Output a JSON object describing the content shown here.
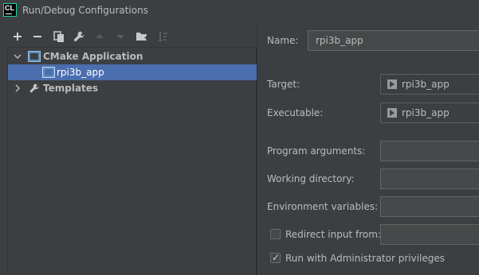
{
  "window": {
    "title": "Run/Debug Configurations",
    "logo_text": "CL"
  },
  "toolbar": {
    "buttons": [
      "add",
      "remove",
      "copy",
      "edit-defaults",
      "move-up",
      "move-down",
      "new-folder",
      "sort"
    ]
  },
  "tree": {
    "items": [
      {
        "label": "CMake Application",
        "expanded": true,
        "bold": true
      },
      {
        "label": "rpi3b_app",
        "selected": true
      },
      {
        "label": "Templates",
        "expanded": false,
        "bold": true
      }
    ]
  },
  "form": {
    "name_label": "Name:",
    "name_value": "rpi3b_app",
    "target_label": "Target:",
    "target_value": "rpi3b_app",
    "executable_label": "Executable:",
    "executable_value": "rpi3b_app",
    "program_args_label": "Program arguments:",
    "program_args_value": "",
    "working_dir_label": "Working directory:",
    "working_dir_value": "",
    "env_vars_label": "Environment variables:",
    "env_vars_value": "",
    "redirect_label": "Redirect input from:",
    "redirect_checked": false,
    "redirect_value": "",
    "admin_label": "Run with Administrator privileges",
    "admin_checked": true
  },
  "colors": {
    "background": "#3c3f41",
    "selection": "#4b6eaf",
    "text": "#bbbbbb"
  }
}
